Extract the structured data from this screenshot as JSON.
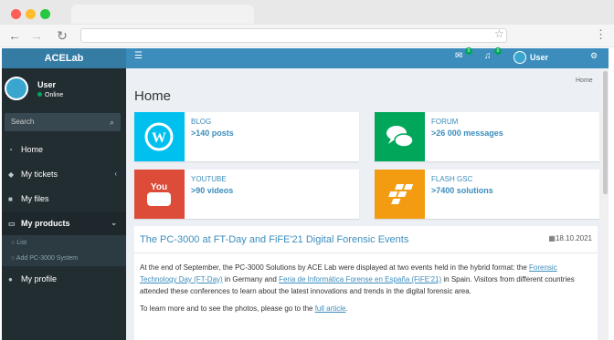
{
  "app": {
    "name": "ACELab"
  },
  "user": {
    "name": "User",
    "status": "Online"
  },
  "search": {
    "placeholder": "Search"
  },
  "sidebar": {
    "items": [
      {
        "label": "Home"
      },
      {
        "label": "My tickets"
      },
      {
        "label": "My files"
      },
      {
        "label": "My products"
      },
      {
        "label": "My profile"
      }
    ],
    "submenu": [
      {
        "label": "List"
      },
      {
        "label": "Add PC-3000 System"
      }
    ]
  },
  "header": {
    "messages_count": "0",
    "notifications_count": "0",
    "user_name": "User"
  },
  "breadcrumb": "Home",
  "page_title": "Home",
  "info_boxes": [
    {
      "label": "BLOG",
      "value": ">140 posts",
      "color": "#00c0ef"
    },
    {
      "label": "FORUM",
      "value": ">26 000 messages",
      "color": "#00a65a"
    },
    {
      "label": "YOUTUBE",
      "value": ">90 videos",
      "color": "#dd4b39"
    },
    {
      "label": "FLASH GSC",
      "value": ">7400 solutions",
      "color": "#f39c12"
    }
  ],
  "youtube_logo_text": "You Tube",
  "article": {
    "title": "The PC-3000 at FT-Day and FiFE'21 Digital Forensic Events",
    "date": "18.10.2021",
    "p1_a": "At the end of September, the PC-3000 Solutions by ACE Lab were displayed at two events held in the hybrid format: the ",
    "link1": "Forensic Technology Day (FT-Day)",
    "p1_b": " in Germany and ",
    "link2": "Feria de Informática Forense en España (FiFE'21)",
    "p1_c": " in Spain. Visitors from different countries attended these conferences to learn about the latest innovations and trends in the digital forensic area.",
    "p2_a": "To learn more and to see the photos, please go to the ",
    "link3": "full article",
    "p2_b": "."
  }
}
